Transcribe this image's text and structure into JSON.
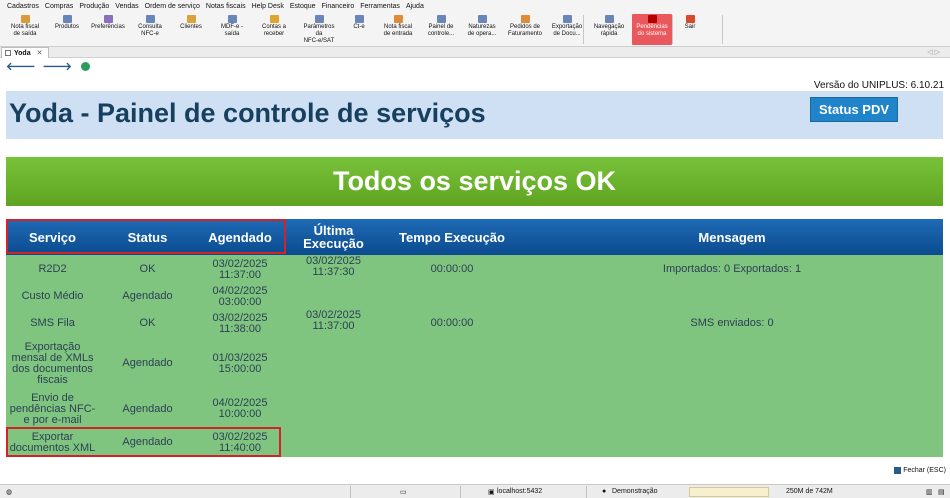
{
  "menu": [
    "Cadastros",
    "Compras",
    "Produção",
    "Vendas",
    "Ordem de serviço",
    "Notas fiscais",
    "Help Desk",
    "Estoque",
    "Financeiro",
    "Ferramentas",
    "Ajuda"
  ],
  "toolbar": [
    {
      "label": "Nota fiscal\nde saída",
      "icon": "invoice-out-icon",
      "color": "#d99a3c"
    },
    {
      "label": "Produtos",
      "icon": "box-icon",
      "color": "#6a86b8"
    },
    {
      "label": "Preferências",
      "icon": "preferences-icon",
      "color": "#8d6fc0"
    },
    {
      "label": "Consulta\nNFC-e",
      "icon": "document-search-icon",
      "color": "#6a86b8"
    },
    {
      "label": "Clientes",
      "icon": "people-icon",
      "color": "#d9a23c"
    },
    {
      "label": "MDF-e -\nsaída",
      "icon": "document-icon",
      "color": "#6a86b8"
    },
    {
      "label": "Contas a\nreceber",
      "icon": "coins-icon",
      "color": "#e0a52e"
    },
    {
      "label": "Parâmetros\nda\nNFC-e/SAT",
      "icon": "settings-doc-icon",
      "color": "#6a86b8"
    },
    {
      "label": "Ct-e",
      "icon": "document-icon",
      "color": "#6a86b8"
    },
    {
      "label": "Nota fiscal\nde entrada",
      "icon": "invoice-in-icon",
      "color": "#e08a3c"
    },
    {
      "label": "Painel de\ncontrole...",
      "icon": "dashboard-icon",
      "color": "#6a86b8"
    },
    {
      "label": "Naturezas\nde opera...",
      "icon": "list-icon",
      "color": "#6a86b8"
    },
    {
      "label": "Pedidos de\nFaturamento",
      "icon": "cart-icon",
      "color": "#e08a3c"
    },
    {
      "label": "Exportação\nde Docu...",
      "icon": "export-icon",
      "color": "#6a86b8"
    },
    {
      "label": "Navegação\nrápida",
      "icon": "navigation-icon",
      "color": "#6a86b8"
    },
    {
      "label": "Pendências\ndo sistema",
      "icon": "alert-icon",
      "color": "#b30000"
    },
    {
      "label": "Sair",
      "icon": "power-icon",
      "color": "#d94a2a"
    }
  ],
  "tab": {
    "label": "Yoda",
    "close": "✕"
  },
  "tab_nav": "◁ ▷",
  "nav": {
    "back": "🡐",
    "forward": "🡒"
  },
  "version": "Versão do UNIPLUS: 6.10.21",
  "title": "Yoda - Painel de controle de serviços",
  "status_pdv": "Status PDV",
  "banner": "Todos os serviços OK",
  "table": {
    "headers": [
      "Serviço",
      "Status",
      "Agendado",
      "Última\nExecução",
      "Tempo Execução",
      "Mensagem"
    ],
    "rows": [
      {
        "servico": "R2D2",
        "status": "OK",
        "agendado": "03/02/2025\n11:37:00",
        "ultima": "03/02/2025\n11:37:30",
        "tempo": "00:00:00",
        "mensagem": "Importados: 0 Exportados: 1"
      },
      {
        "servico": "Custo Médio",
        "status": "Agendado",
        "agendado": "04/02/2025\n03:00:00",
        "ultima": "",
        "tempo": "",
        "mensagem": ""
      },
      {
        "servico": "SMS Fila",
        "status": "OK",
        "agendado": "03/02/2025\n11:38:00",
        "ultima": "03/02/2025\n11:37:00",
        "tempo": "00:00:00",
        "mensagem": "SMS enviados: 0"
      },
      {
        "servico": "Exportação\nmensal de XMLs\ndos documentos\nfiscais",
        "status": "Agendado",
        "agendado": "01/03/2025\n15:00:00",
        "ultima": "",
        "tempo": "",
        "mensagem": ""
      },
      {
        "servico": "Envio de\npendências NFC-\ne por e-mail",
        "status": "Agendado",
        "agendado": "04/02/2025\n10:00:00",
        "ultima": "",
        "tempo": "",
        "mensagem": ""
      },
      {
        "servico": "Exportar\ndocumentos XML",
        "status": "Agendado",
        "agendado": "03/02/2025\n11:40:00",
        "ultima": "",
        "tempo": "",
        "mensagem": ""
      }
    ]
  },
  "fechar": "Fechar (ESC)",
  "statusbar": {
    "server": "localhost:5432",
    "user": "Demonstração",
    "memory": "250M de 742M"
  }
}
